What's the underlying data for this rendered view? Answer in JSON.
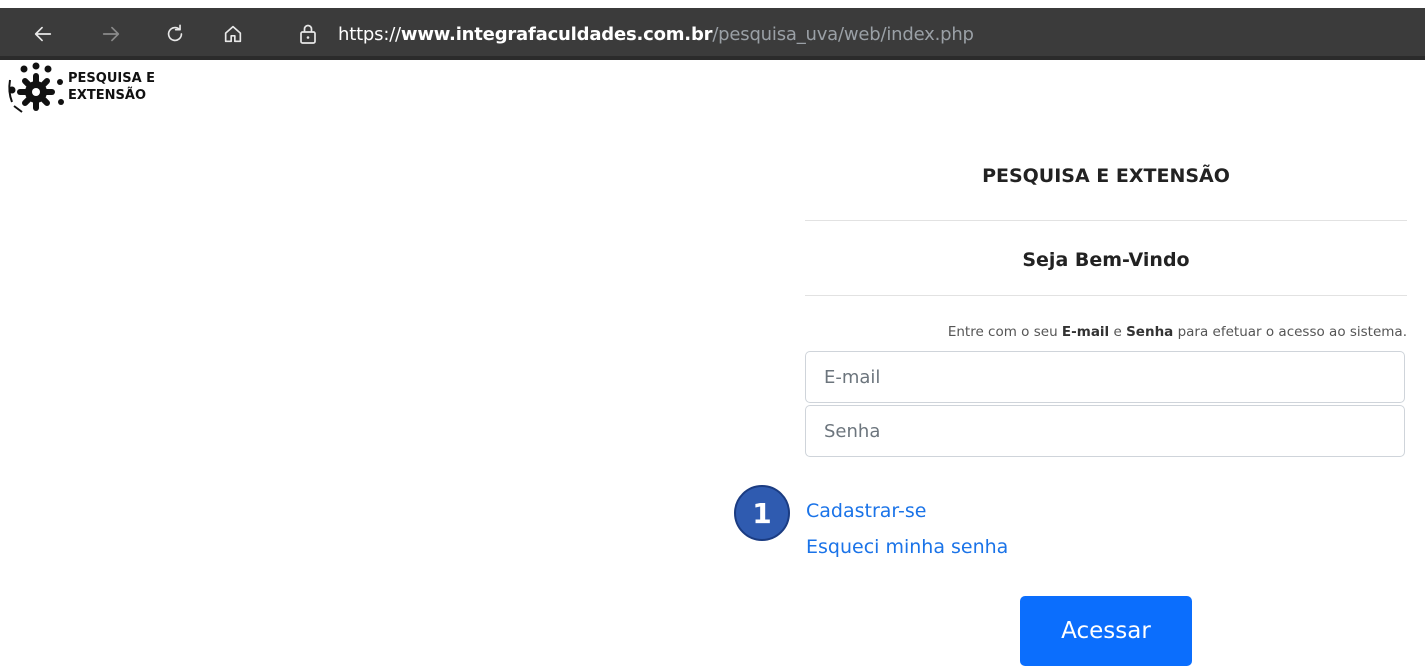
{
  "browser": {
    "url_scheme": "https://",
    "url_host": "www.integrafaculdades.com.br",
    "url_path": "/pesquisa_uva/web/index.php",
    "icons": [
      "back-icon",
      "forward-icon",
      "refresh-icon",
      "home-icon",
      "lock-icon"
    ]
  },
  "logo": {
    "line1": "PESQUISA E",
    "line2": "EXTENSÃO"
  },
  "login": {
    "title": "PESQUISA E EXTENSÃO",
    "welcome": "Seja Bem-Vindo",
    "hint_prefix": "Entre com o seu ",
    "hint_email": "E-mail",
    "hint_mid": " e ",
    "hint_senha": "Senha",
    "hint_suffix": " para efetuar o acesso ao sistema.",
    "email_placeholder": "E-mail",
    "password_placeholder": "Senha",
    "register_link": "Cadastrar-se",
    "forgot_link": "Esqueci minha senha",
    "submit_label": "Acessar"
  },
  "annotation": {
    "marker_label": "1"
  },
  "colors": {
    "toolbar": "#3b3b3b",
    "link": "#1a73e8",
    "button": "#0b6efd",
    "marker": "#2f5bb0"
  }
}
